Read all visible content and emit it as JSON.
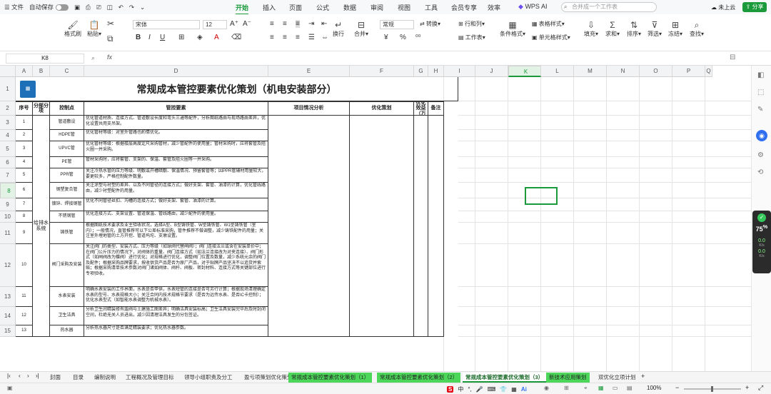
{
  "menubar": {
    "file": "文件",
    "autosave": "自动保存",
    "tabs": [
      "开始",
      "插入",
      "页面",
      "公式",
      "数据",
      "审阅",
      "视图",
      "工具",
      "会员专享",
      "效率",
      "WPS AI"
    ],
    "active_tab": "开始",
    "search_placeholder": "合并成一个工作表",
    "cloud": "未上云",
    "share": "分享"
  },
  "ribbon": {
    "format_painter": "格式刷",
    "paste": "粘贴",
    "font_name": "宋体",
    "font_size": "12",
    "number_format": "常规",
    "convert": "转换",
    "rows_cols": "行和列",
    "wrap": "换行",
    "merge": "合并",
    "worksheet": "工作表",
    "conditional": "条件格式",
    "table_style": "表格样式",
    "cell_style": "单元格样式",
    "fill": "填充",
    "sum": "求和",
    "sort": "排序",
    "filter": "筛选",
    "freeze": "冻结",
    "find": "查找"
  },
  "formula": {
    "namebox": "K8",
    "fx": "fx"
  },
  "columns": [
    "A",
    "B",
    "C",
    "D",
    "E",
    "F",
    "G",
    "H",
    "I",
    "J",
    "K",
    "L",
    "M",
    "N",
    "O",
    "P",
    "Q"
  ],
  "selected_column": "K",
  "selected_row": "8",
  "sheet": {
    "title": "常规成本管控要素优化策划（机电安装部分）",
    "headers": [
      "序号",
      "分部分项",
      "控制点",
      "管控要素",
      "项目情况分析",
      "优化策划",
      "预计优化效益（万元）",
      "备注"
    ],
    "group_label": "给排水系统",
    "rows": [
      {
        "rn": "3",
        "no": "1",
        "ctrl": "管道敷设",
        "text": "优化管道材质、连接方式、管道敷设长度和弯头三通等配件，分析图纸路由与现场路由差异，优化设置共用支吊架。"
      },
      {
        "rn": "4",
        "no": "2",
        "ctrl": "HDPE管",
        "text": "优化管材等级：对室外管路也酌情优化。"
      },
      {
        "rn": "5",
        "no": "3",
        "ctrl": "UPVC管",
        "text": "优化管材等级：根据楼层高度定尺采购管材，减少管配件的使用量；管材采购时，应将套管及阻火圈一并采购。"
      },
      {
        "rn": "6",
        "no": "4",
        "ctrl": "PE管",
        "text": "管材采购时，应将套管、支架的、保温、套管及阻火圈等一并采购。"
      },
      {
        "rn": "7",
        "no": "5",
        "ctrl": "PPR管",
        "text": "关注冷热水管的压力等级、明敷或开槽暗敷、保温情况、预留套管等；因PPR管辅材用量较大，要更较多，严格控制配件数量。"
      },
      {
        "rn": "8",
        "no": "6",
        "ctrl": "钢塑复合管",
        "text": "关注涂塑与衬塑的差异、以及不同管径的连接方式；做好支架、套管、油漆的计算，优化管线路由，减少衬塑配件的用量。"
      },
      {
        "rn": "9",
        "no": "7",
        "ctrl": "镀锌、焊接钢管",
        "text": "优化不同管径丝扣、沟槽的连接方式；做好支架、套管、油漆的计算。"
      },
      {
        "rn": "10",
        "no": "8",
        "ctrl": "不锈钢管",
        "text": "优化连接方式、支架设置、管道保温、管线路由，减少配件的使用量。"
      },
      {
        "rn": "11",
        "no": "9",
        "ctrl": "铸铁管",
        "text": "根据图纸技术要求及业主验收状况，选择A型、B型铸铁管、W型铸铁管、W1型铸铁管（室内）；一般情况，直管推荐可以下公差标准采购，管件推荐不做调整，减少铸铁配件的用量；关注室外埋地管的土方开挖、管道坞坨、支墩设置。"
      },
      {
        "rn": "12",
        "no": "10",
        "ctrl": "阀门采购及安装",
        "text": "关注阀门的类型、安装方式、压力等级（如球阀代替闸阀）；阀门连接法兰或含在安装单价中；在阀门公斤压力的情况下，对阀体的重量、阀门连接方式（如法兰连接改为对夹连接）、阀门形式（如闸阀改为蝶阀）进行优化；对规格进行优化，调整阀门位置及数量，减少系统元余的阀门及配件；根据采购品牌要求，按收供货产品是否为原厂产品，对于贴牌产品坚决不以追货并索赔；根据采购清单技术参数对阀门诸如阀体、阀杆、阀板、密封材料、连接方式等关键部位进行专项验收。"
      },
      {
        "rn": "13",
        "no": "11",
        "ctrl": "水表安装",
        "text": "明确水表安装的工作界面，水表是否甲供，水表短管的连接是否可另行计算；根据现场清理确定水表的型号、水表规格大小；关注合同内技术规格节要求（是否为远传水表、是否IC卡控制）；优化水表型式（如智能水表调整为机械水表）。"
      },
      {
        "rn": "14",
        "no": "12",
        "ctrl": "卫生洁具",
        "text": "分析卫生间精装修有露阀与土建施工图差异；明确洁具安装标高；卫生洁具安装完毕后及时封闭空间，杜绝无关人员进出，减少因清理洁具发生的分包签证。"
      },
      {
        "rn": "15",
        "no": "13",
        "ctrl": "热水器",
        "text": "分析热水器尺寸是否满足精装要求；优化热水器参数。"
      }
    ]
  },
  "sheet_tabs": [
    "封面",
    "目录",
    "编制说明",
    "工程概况及管理目标",
    "领导小组职责及分工",
    "盈亏项策划优化策划",
    "常规成本管控要素优化策划（1）",
    "常规成本管控要素优化策划（2）",
    "常规成本管控要素优化策划（3）",
    "新技术应用策划",
    "双优化立项计划"
  ],
  "active_sheet": "常规成本管控要素优化策划（3）",
  "status": {
    "zoom": "100%",
    "ime": "中"
  },
  "perf": {
    "pct": "75",
    "up": "0.0",
    "down": "0.0",
    "unit": "K/s"
  },
  "colors": {
    "accent": "#1a9a3a",
    "tab_green": "#4cd65a"
  }
}
